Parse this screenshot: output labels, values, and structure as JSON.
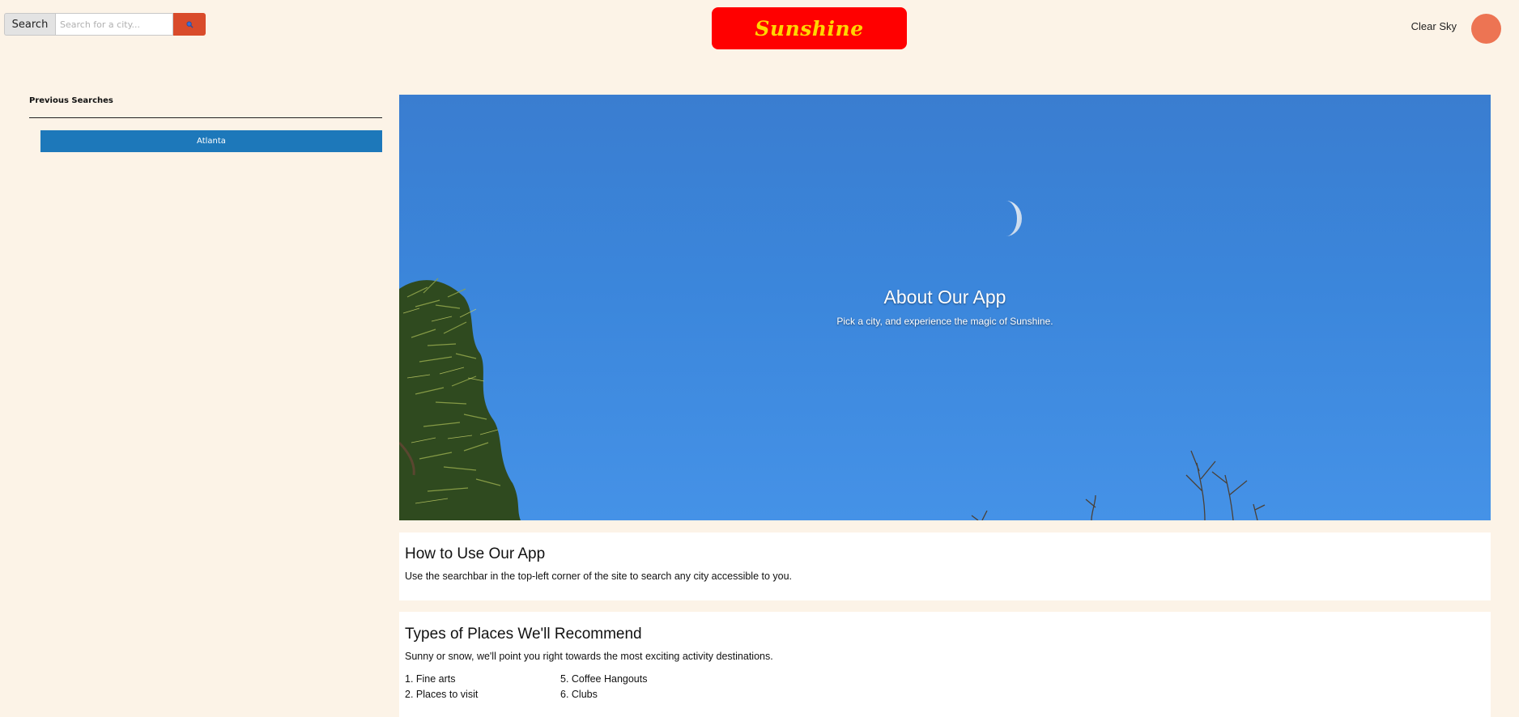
{
  "header": {
    "search": {
      "label": "Search",
      "placeholder": "Search for a city...",
      "value": "",
      "button_icon": "search-icon"
    },
    "brand": "Sunshine",
    "weather_status": "Clear Sky"
  },
  "sidebar": {
    "title": "Previous Searches",
    "items": [
      {
        "label": "Atlanta"
      }
    ]
  },
  "hero": {
    "title": "About Our App",
    "subtitle": "Pick a city, and experience the magic of Sunshine."
  },
  "how_to": {
    "title": "How to Use Our App",
    "text": "Use the searchbar in the top-left corner of the site to search any city accessible to you."
  },
  "recommendations": {
    "title": "Types of Places We'll Recommend",
    "text": "Sunny or snow, we'll point you right towards the most exciting activity destinations.",
    "column_1": [
      "1. Fine arts",
      "2. Places to visit"
    ],
    "column_2": [
      "5. Coffee Hangouts",
      "6. Clubs"
    ]
  },
  "colors": {
    "background": "#fcf3e7",
    "brand_bg": "#ff0000",
    "brand_text": "#ffd600",
    "search_button": "#d94b2b",
    "history_item": "#1d78ba",
    "weather_dot": "#ed7453",
    "sky": "#3b86db"
  }
}
